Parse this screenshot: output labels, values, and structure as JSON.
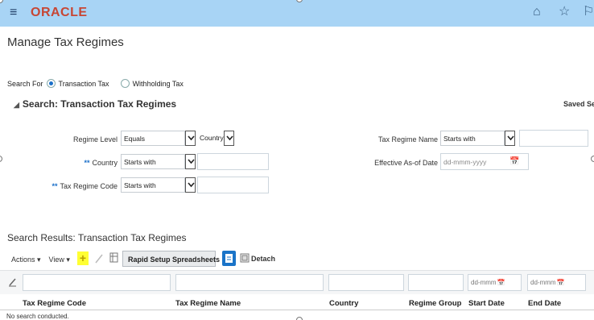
{
  "header": {
    "logo": "ORACLE",
    "menu_glyph": "≡",
    "home_glyph": "⌂",
    "star_glyph": "☆",
    "flag_glyph": "⚐"
  },
  "page": {
    "title": "Manage Tax Regimes"
  },
  "search_for": {
    "label": "Search For",
    "options": [
      "Transaction Tax",
      "Withholding Tax"
    ],
    "selected": "Transaction Tax"
  },
  "search_section": {
    "title": "Search: Transaction Tax Regimes",
    "saved_search": "Saved Sear",
    "fields": {
      "regime_level_label": "Regime Level",
      "regime_level_op": "Equals",
      "regime_level_value": "Country",
      "tax_regime_name_label": "Tax Regime Name",
      "tax_regime_name_op": "Starts with",
      "country_label": "Country",
      "country_op": "Starts with",
      "effective_date_label": "Effective As-of Date",
      "effective_date_placeholder": "dd-mmm-yyyy",
      "regime_code_label": "Tax Regime Code",
      "regime_code_op": "Starts with",
      "required_marker": "**"
    }
  },
  "results": {
    "title": "Search Results: Transaction Tax Regimes",
    "toolbar": {
      "actions": "Actions ▾",
      "view": "View ▾",
      "add": "+",
      "rapid_setup": "Rapid Setup Spreadsheets ▼",
      "detach": "Detach"
    },
    "filter_date_placeholder": "dd-mmm",
    "columns": [
      "Tax Regime Code",
      "Tax Regime Name",
      "Country",
      "Regime Group",
      "Start Date",
      "End Date"
    ],
    "empty_message": "No search conducted."
  },
  "colors": {
    "header_bg": "#a8d4f5",
    "brand": "#c74634",
    "accent": "#1a74c8",
    "highlight": "#ffff33"
  }
}
